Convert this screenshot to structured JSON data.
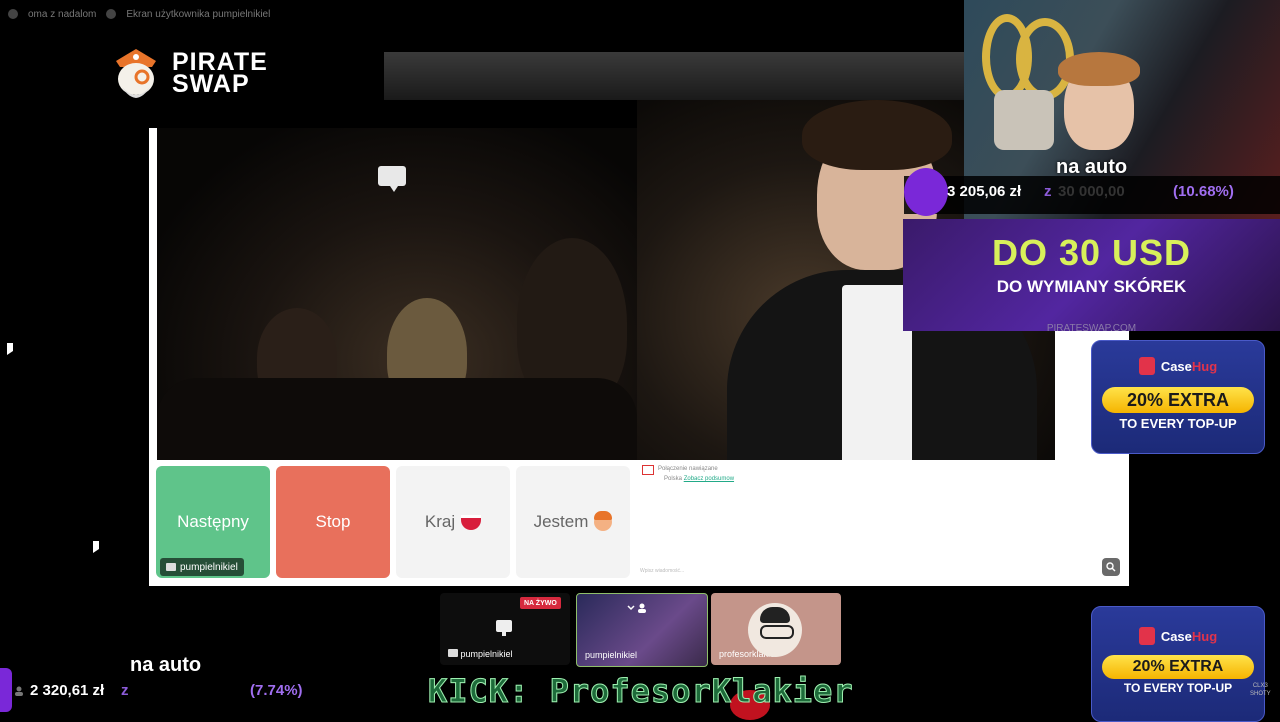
{
  "topbar": {
    "left_text": "oma z nadalom",
    "right_text": "Ekran użytkownika pumpielnikiel"
  },
  "logo": {
    "line1": "PIRATE",
    "line2": "SWAP"
  },
  "video": {
    "chat_icon": "chat-bubble-icon"
  },
  "buttons": {
    "next_label": "Następny",
    "stop_label": "Stop",
    "country_label": "Kraj",
    "gender_label": "Jestem"
  },
  "user_tag": {
    "name": "pumpielnikiel"
  },
  "chat": {
    "line1": "Połączenie nawiązane",
    "line2_prefix": "Polska",
    "line2_link": "Zobacz podsumow",
    "input_placeholder": "Wpisz wiadomość..."
  },
  "webcam_goal": {
    "caption": "na auto",
    "amount": "3 205,06 zł",
    "z": "z",
    "target": "30 000,00",
    "percent": "(10.68%)"
  },
  "promo": {
    "main": "DO 30 USD",
    "sub": "DO WYMIANY SKÓREK",
    "url": "PIRATESWAP.COM"
  },
  "casehug_ads": [
    {
      "brand_a": "Case",
      "brand_b": "Hug",
      "pill": "20% EXTRA",
      "sub": "TO EVERY TOP-UP"
    },
    {
      "brand_a": "Case",
      "brand_b": "Hug",
      "pill": "20% EXTRA",
      "sub": "TO EVERY TOP-UP"
    }
  ],
  "thumbnails": [
    {
      "label": "pumpielnikiel",
      "badge": "NA ŻYWO"
    },
    {
      "label": "pumpielnikiel"
    },
    {
      "label": "profesorklakier"
    }
  ],
  "bottom_goal": {
    "caption": "na auto",
    "amount": "2 320,61 zł",
    "z": "z",
    "percent": "(7.74%)"
  },
  "kick_banner": "KICK: ProfesorKlakier",
  "watermark": "CLX3\nSHOTY",
  "colors": {
    "next_green": "#5fc48a",
    "stop_red": "#e8705c",
    "promo_yellow": "#d8f05a",
    "goal_purple": "#a06ef0",
    "kick_green": "#1e6b3a"
  }
}
